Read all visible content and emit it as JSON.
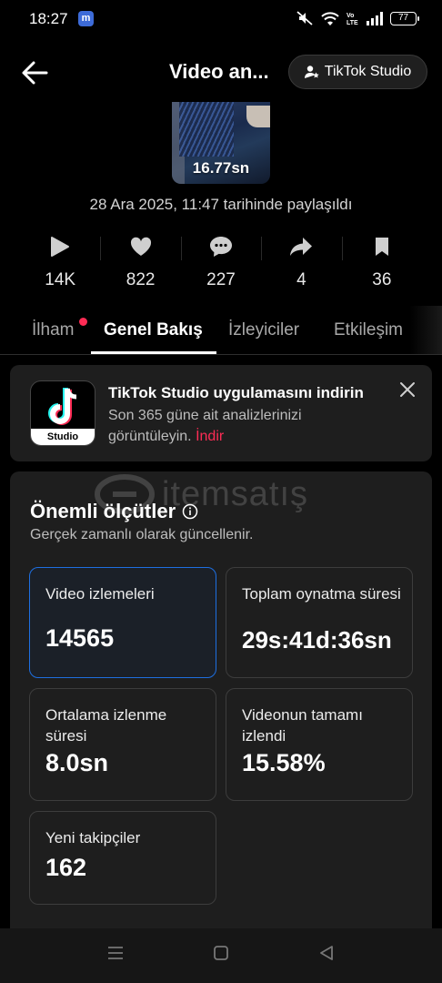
{
  "status_bar": {
    "time": "18:27",
    "battery": "77",
    "app_badge": "m"
  },
  "header": {
    "title": "Video an...",
    "studio_button": "TikTok Studio"
  },
  "video": {
    "duration": "16.77sn",
    "shared_text": "28 Ara 2025, 11:47 tarihinde paylaşıldı"
  },
  "stats": [
    {
      "icon": "play-icon",
      "value": "14K"
    },
    {
      "icon": "heart-icon",
      "value": "822"
    },
    {
      "icon": "comment-icon",
      "value": "227"
    },
    {
      "icon": "share-icon",
      "value": "4"
    },
    {
      "icon": "bookmark-icon",
      "value": "36"
    }
  ],
  "tabs": [
    {
      "label": "İlham",
      "active": false
    },
    {
      "label": "Genel Bakış",
      "active": true
    },
    {
      "label": "İzleyiciler",
      "active": false
    },
    {
      "label": "Etkileşim",
      "active": false
    }
  ],
  "banner": {
    "title": "TikTok Studio uygulamasını indirin",
    "text": "Son 365 güne ait analizlerinizi görüntüleyin.",
    "link": "İndir",
    "icon_label": "Studio"
  },
  "watermark": {
    "text": "itemsatış"
  },
  "metrics": {
    "title": "Önemli ölçütler",
    "subtitle": "Gerçek zamanlı olarak güncellenir.",
    "cards": [
      {
        "label": "Video izlemeleri",
        "value": "14565"
      },
      {
        "label": "Toplam oynatma süresi",
        "value": "29s:41d:36sn"
      },
      {
        "label": "Ortalama izlenme süresi",
        "value": "8.0sn"
      },
      {
        "label": "Videonun tamamı izlendi",
        "value": "15.58%"
      },
      {
        "label": "Yeni takipçiler",
        "value": "162"
      }
    ]
  },
  "colors": {
    "accent_red": "#fe2c55",
    "selected_border": "#1e6fe0",
    "card_bg": "#1e1e1e"
  }
}
